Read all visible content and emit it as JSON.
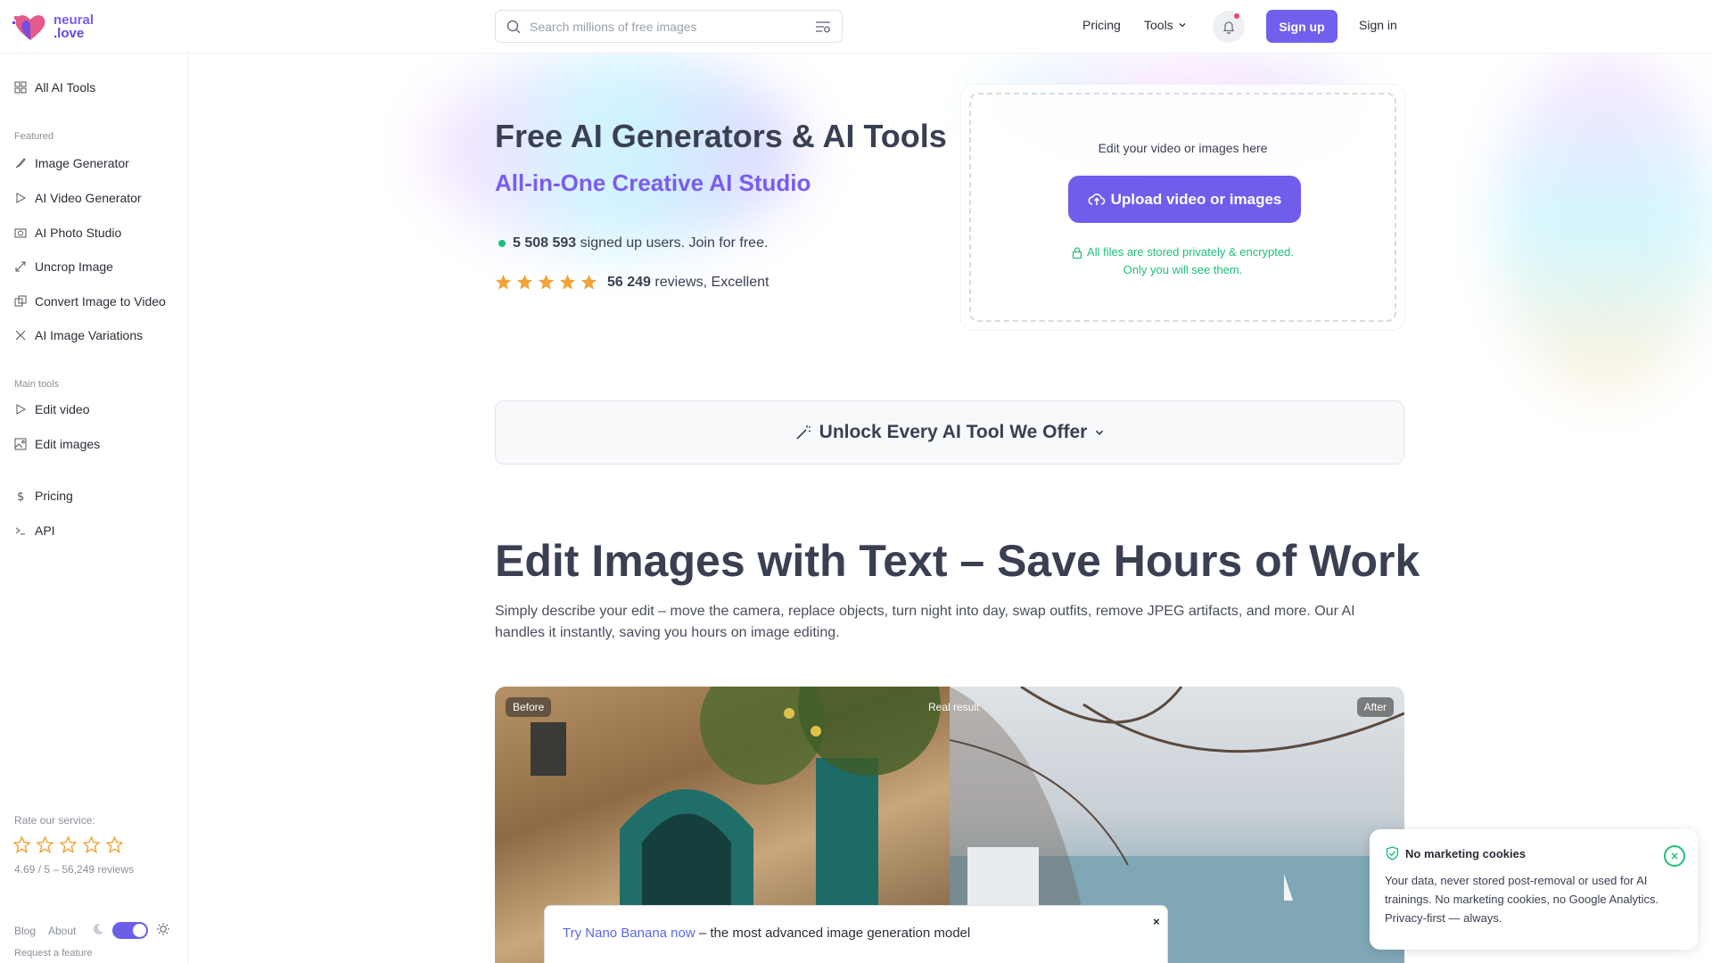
{
  "brand": {
    "line1": "neural",
    "line2": ".love"
  },
  "search": {
    "placeholder": "Search millions of free images"
  },
  "nav": {
    "pricing": "Pricing",
    "tools": "Tools",
    "signup": "Sign up",
    "signin": "Sign in"
  },
  "sidebar": {
    "all_tools": "All AI Tools",
    "featured_label": "Featured",
    "featured": [
      {
        "label": "Image Generator",
        "icon": "brush-icon"
      },
      {
        "label": "AI Video Generator",
        "icon": "play-icon"
      },
      {
        "label": "AI Photo Studio",
        "icon": "camera-icon"
      },
      {
        "label": "Uncrop Image",
        "icon": "expand-icon"
      },
      {
        "label": "Convert Image to Video",
        "icon": "convert-icon"
      },
      {
        "label": "AI Image Variations",
        "icon": "shuffle-icon"
      }
    ],
    "main_label": "Main tools",
    "main": [
      {
        "label": "Edit video",
        "icon": "play-icon"
      },
      {
        "label": "Edit images",
        "icon": "image-icon"
      }
    ],
    "pricing": "Pricing",
    "api": "API",
    "rate_title": "Rate our service:",
    "rate_summary": "4.69 / 5 – 56,249 reviews",
    "blog": "Blog",
    "about": "About",
    "request": "Request a feature"
  },
  "hero": {
    "title": "Free AI Generators & AI Tools",
    "subtitle": "All-in-One Creative AI Studio",
    "users_count": "5 508 593",
    "users_text": "signed up users. Join for free.",
    "reviews_count": "56 249",
    "reviews_text": "reviews, Excellent",
    "rating": 5
  },
  "upload": {
    "label": "Edit your video or images here",
    "button": "Upload video or images",
    "secure_1": "All files are stored privately & encrypted.",
    "secure_2": "Only you will see them."
  },
  "unlock": {
    "label": "Unlock Every AI Tool We Offer"
  },
  "section": {
    "title": "Edit Images with Text – Save Hours of Work",
    "desc": "Simply describe your edit – move the camera, replace objects, turn night into day, swap outfits, remove JPEG artifacts, and more. Our AI handles it instantly, saving you hours on image editing."
  },
  "compare": {
    "before": "Before",
    "real": "Real result",
    "after": "After"
  },
  "banner": {
    "link": "Try Nano Banana now",
    "text": " – the most advanced image generation model",
    "close": "×"
  },
  "cookie": {
    "title": "No marketing cookies",
    "text": "Your data, never stored post-removal or used for AI trainings. No marketing cookies, no Google Analytics. Privacy-first — always."
  },
  "colors": {
    "accent": "#7160ee",
    "success": "#1ebf7a",
    "star": "#f0a43a"
  }
}
